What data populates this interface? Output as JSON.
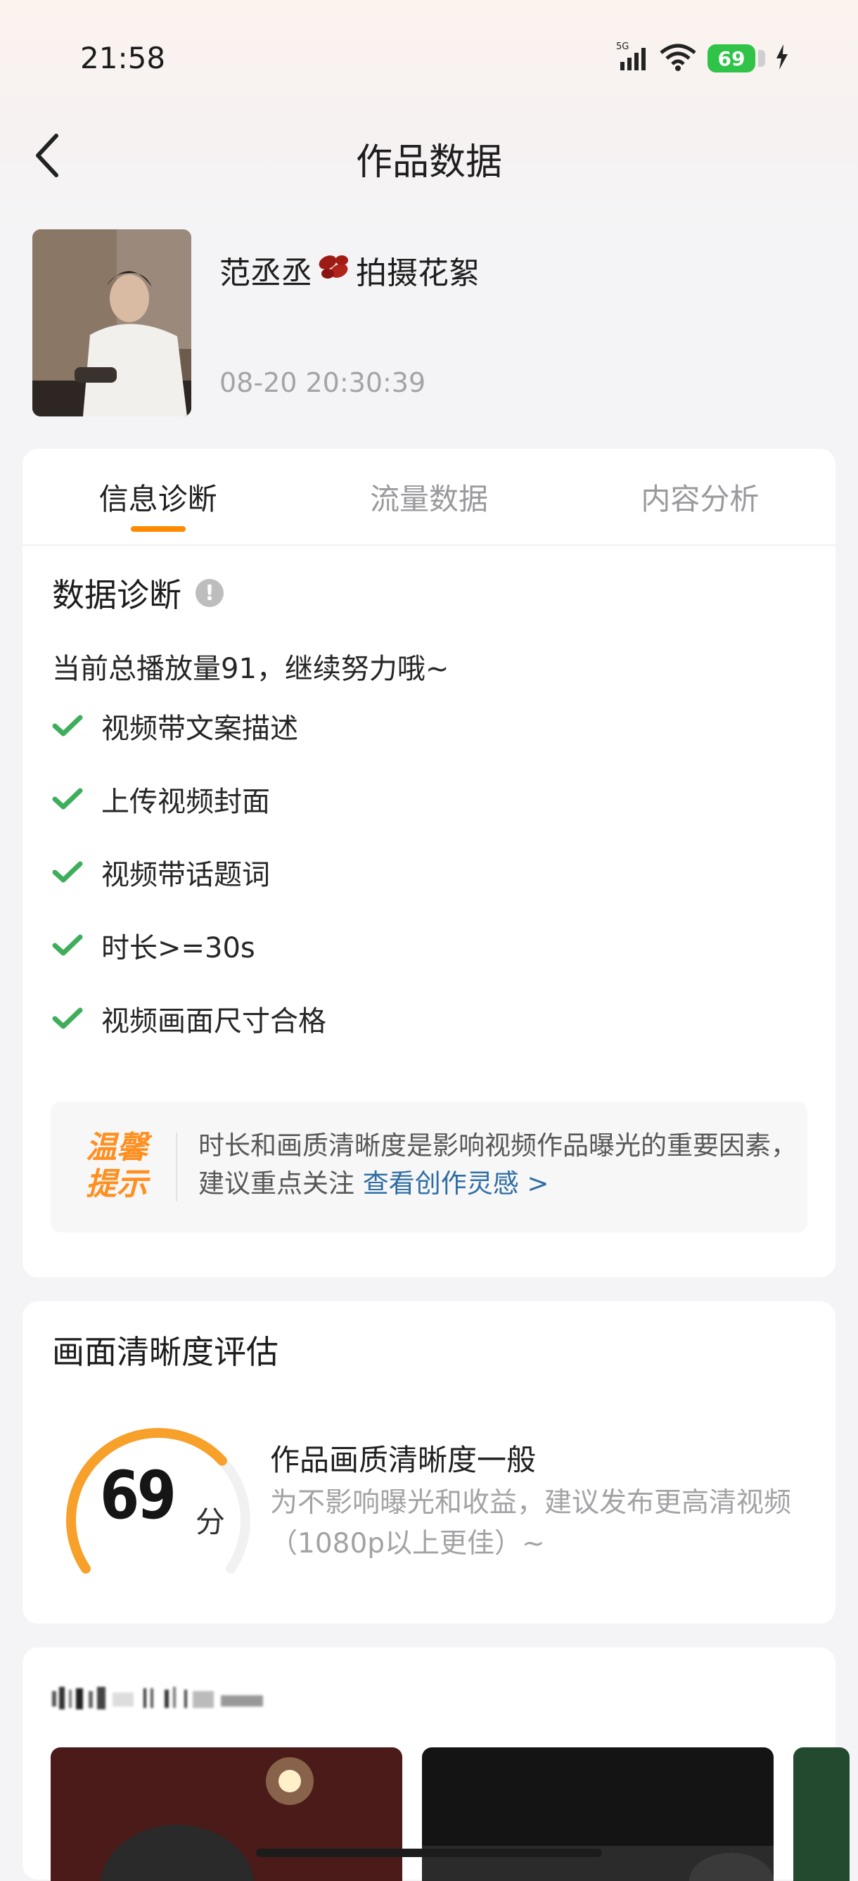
{
  "status_bar": {
    "time": "21:58",
    "network": "5G",
    "battery": "69"
  },
  "header": {
    "title": "作品数据"
  },
  "video": {
    "title": "范丞丞",
    "title_suffix": "拍摄花絮",
    "time": "08-20 20:30:39"
  },
  "tabs": [
    {
      "label": "信息诊断",
      "active": true
    },
    {
      "label": "流量数据",
      "active": false
    },
    {
      "label": "内容分析",
      "active": false
    }
  ],
  "diagnosis": {
    "title": "数据诊断",
    "summary": "当前总播放量91，继续努力哦~",
    "items": [
      "视频带文案描述",
      "上传视频封面",
      "视频带话题词",
      "时长>=30s",
      "视频画面尺寸合格"
    ],
    "tip": {
      "badge_line1": "温馨",
      "badge_line2": "提示",
      "text": "时长和画质清晰度是影响视频作品曝光的重要因素，建议重点关注",
      "link": "查看创作灵感 >"
    }
  },
  "quality": {
    "title": "画面清晰度评估",
    "score": "69",
    "score_max": 100,
    "unit": "分",
    "verdict": "作品画质清晰度一般",
    "desc_line1": "为不影响曝光和收益，建议发布更高清视频",
    "desc_line2": "（1080p以上更佳）~"
  },
  "colors": {
    "accent": "#ff8a00",
    "check": "#3fae5c",
    "link": "#2f6ea3",
    "battery": "#2fc447"
  }
}
